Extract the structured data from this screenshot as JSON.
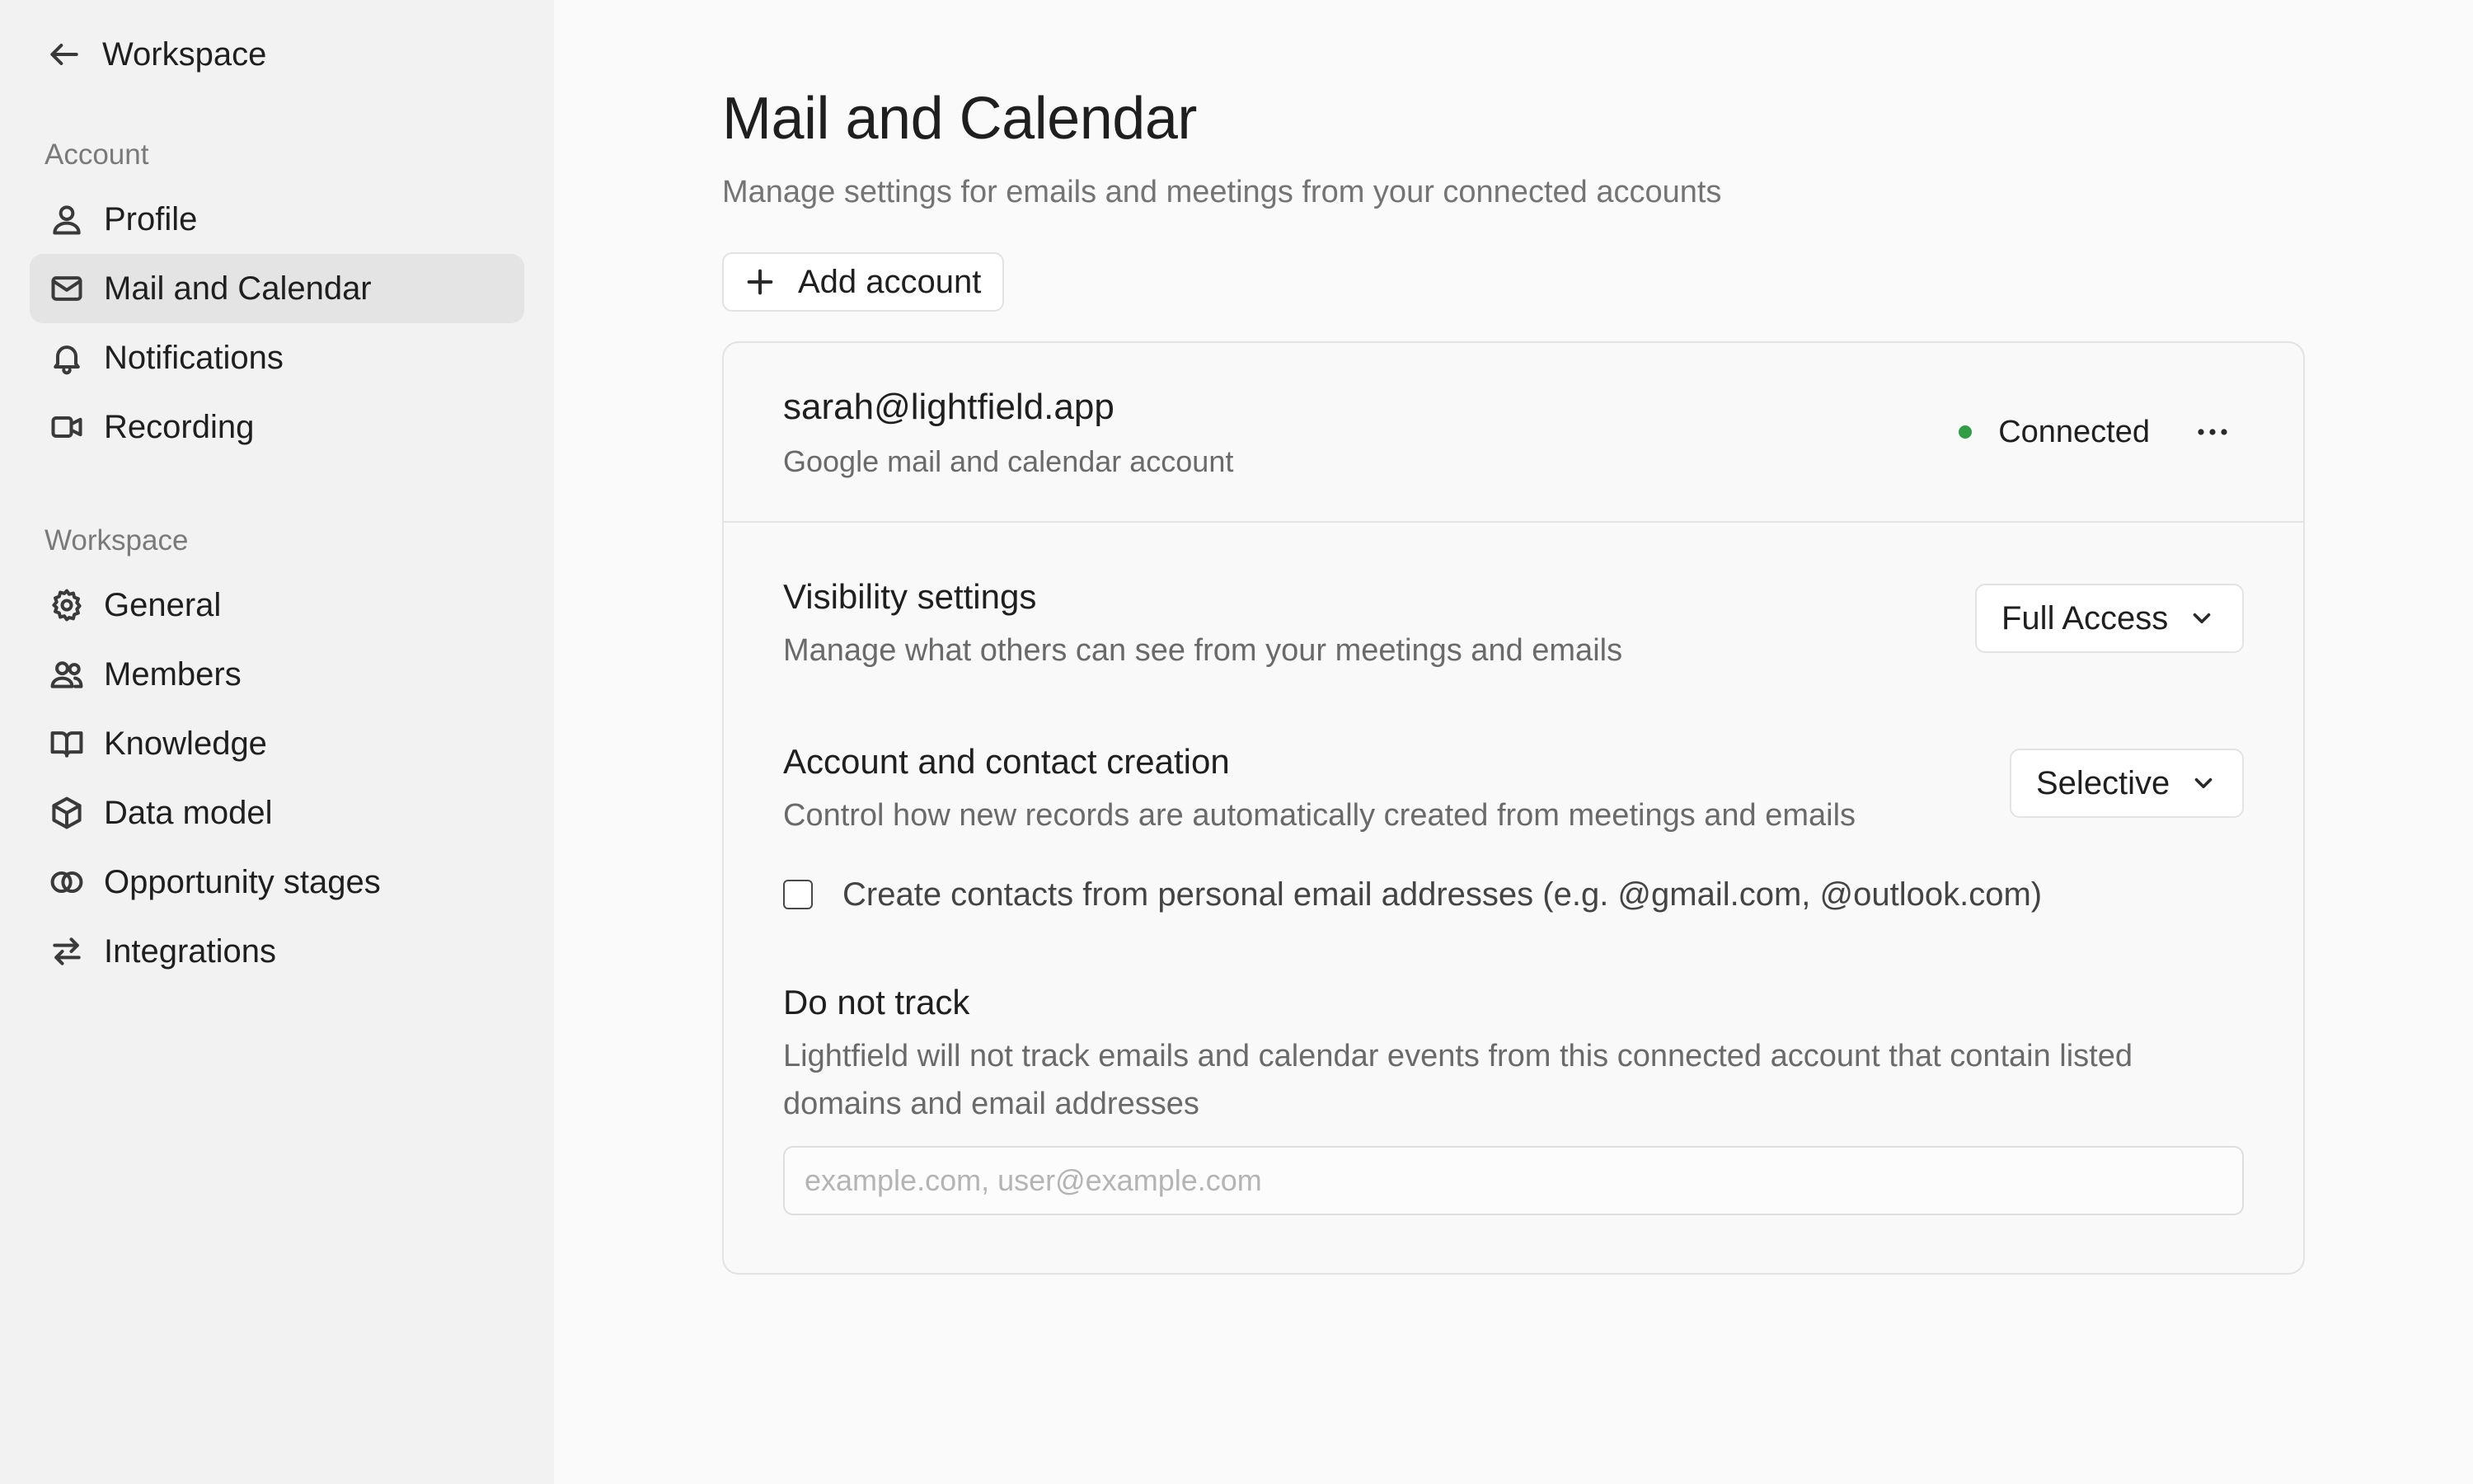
{
  "sidebar": {
    "back_label": "Workspace",
    "account_section_label": "Account",
    "account_items": [
      {
        "label": "Profile",
        "icon": "user-icon"
      },
      {
        "label": "Mail and Calendar",
        "icon": "mail-icon",
        "active": true
      },
      {
        "label": "Notifications",
        "icon": "bell-icon"
      },
      {
        "label": "Recording",
        "icon": "video-icon"
      }
    ],
    "workspace_section_label": "Workspace",
    "workspace_items": [
      {
        "label": "General",
        "icon": "gear-icon"
      },
      {
        "label": "Members",
        "icon": "users-icon"
      },
      {
        "label": "Knowledge",
        "icon": "book-icon"
      },
      {
        "label": "Data model",
        "icon": "cube-icon"
      },
      {
        "label": "Opportunity stages",
        "icon": "circles-icon"
      },
      {
        "label": "Integrations",
        "icon": "arrows-exchange-icon"
      }
    ]
  },
  "main": {
    "title": "Mail and Calendar",
    "subtitle": "Manage settings for emails and meetings from your connected accounts",
    "add_account_label": "Add account",
    "account": {
      "email": "sarah@lightfield.app",
      "description": "Google mail and calendar account",
      "status": "Connected",
      "status_color": "#2f9e44"
    },
    "visibility": {
      "title": "Visibility settings",
      "description": "Manage what others can see from your meetings and emails",
      "selected": "Full Access"
    },
    "creation": {
      "title": "Account and contact creation",
      "description": "Control how new records are automatically created from meetings and emails",
      "selected": "Selective",
      "checkbox_label": "Create contacts from personal email addresses (e.g. @gmail.com, @outlook.com)",
      "checkbox_checked": false
    },
    "do_not_track": {
      "title": "Do not track",
      "description": "Lightfield will not track emails and calendar events from this connected account that contain listed domains and email addresses",
      "value": "",
      "placeholder": "example.com, user@example.com"
    }
  }
}
